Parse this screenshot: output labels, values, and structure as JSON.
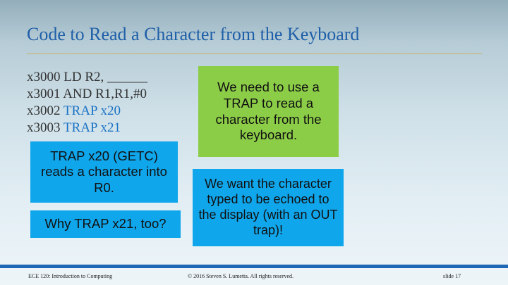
{
  "slide": {
    "title": "Code to Read a Character from the Keyboard",
    "code_lines": [
      {
        "address": "x3000",
        "instruction": "LD R2, ______"
      },
      {
        "address": "x3001",
        "instruction": "AND R1,R1,#0"
      },
      {
        "address": "x3002",
        "instruction": "TRAP x20"
      },
      {
        "address": "x3003",
        "instruction": "TRAP x21"
      }
    ],
    "callouts": {
      "need_trap": "We need to use a TRAP to read a character from the keyboard.",
      "getc": "TRAP x20 (GETC) reads a character into R0.",
      "why_x21": "Why TRAP x21, too?",
      "echo": "We want the character typed to be echoed to the display (with an OUT trap)!"
    },
    "footer": {
      "course": "ECE 120: Introduction to Computing",
      "copyright": "© 2016 Steven S. Lumetta.  All rights reserved.",
      "slide_number": "slide 17"
    }
  },
  "colors": {
    "title": "#1f5fa8",
    "trap_code": "#1a72c4",
    "blue_box": "#10a6ec",
    "green_box": "#8ccd48",
    "footer_bar": "#1f69b4",
    "title_rule": "#c9b36a"
  }
}
